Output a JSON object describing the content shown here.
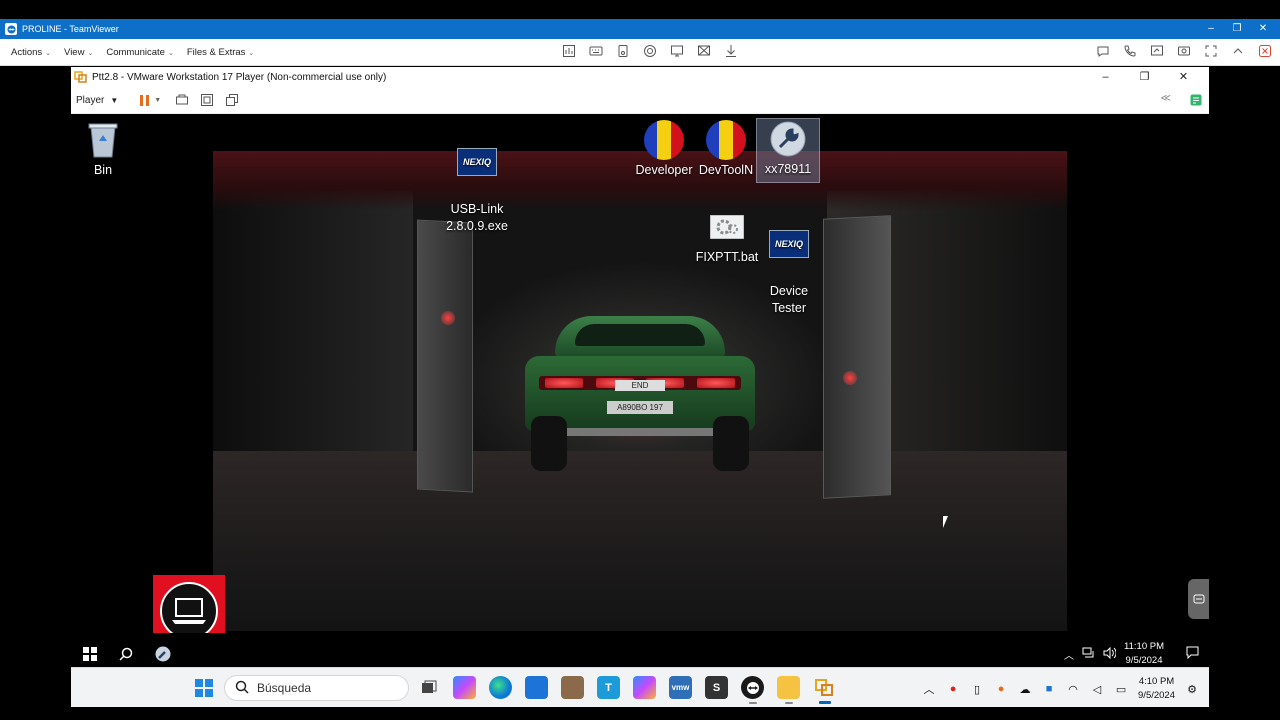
{
  "teamviewer": {
    "title": "PROLINE - TeamViewer",
    "menu": [
      "Actions",
      "View",
      "Communicate",
      "Files & Extras"
    ],
    "window_buttons": [
      "–",
      "❐",
      "✕"
    ],
    "accent": "#0e6fc9"
  },
  "vmware": {
    "title": "Ptt2.8 - VMware Workstation 17 Player (Non-commercial use only)",
    "player_label": "Player",
    "window_buttons": [
      "–",
      "❐",
      "✕"
    ],
    "pause_color": "#e86a1c"
  },
  "desktop": {
    "icons": [
      {
        "label": "Bin",
        "icon": "recycle-bin-icon"
      },
      {
        "label": "USB-Link\n2.8.0.9.exe",
        "icon": "nexiq-icon"
      },
      {
        "label": "Developer",
        "icon": "flag-icon"
      },
      {
        "label": "DevToolN",
        "icon": "flag-icon"
      },
      {
        "label": "xx78911",
        "icon": "wrench-icon"
      },
      {
        "label": "FIXPTT.bat",
        "icon": "gears-icon"
      },
      {
        "label": "Device\nTester",
        "icon": "nexiq-icon"
      }
    ],
    "car_plate_top": "END",
    "car_plate_bottom": "A890BO 197"
  },
  "guest_taskbar": {
    "time": "11:10 PM",
    "date": "9/5/2024"
  },
  "host_taskbar": {
    "search_placeholder": "Búsqueda",
    "time": "4:10 PM",
    "date": "9/5/2024",
    "apps": [
      "files",
      "copilot",
      "edge",
      "store",
      "app",
      "teams",
      "copilot2",
      "vmw",
      "S",
      "teamviewer",
      "explorer",
      "vmplayer"
    ]
  }
}
